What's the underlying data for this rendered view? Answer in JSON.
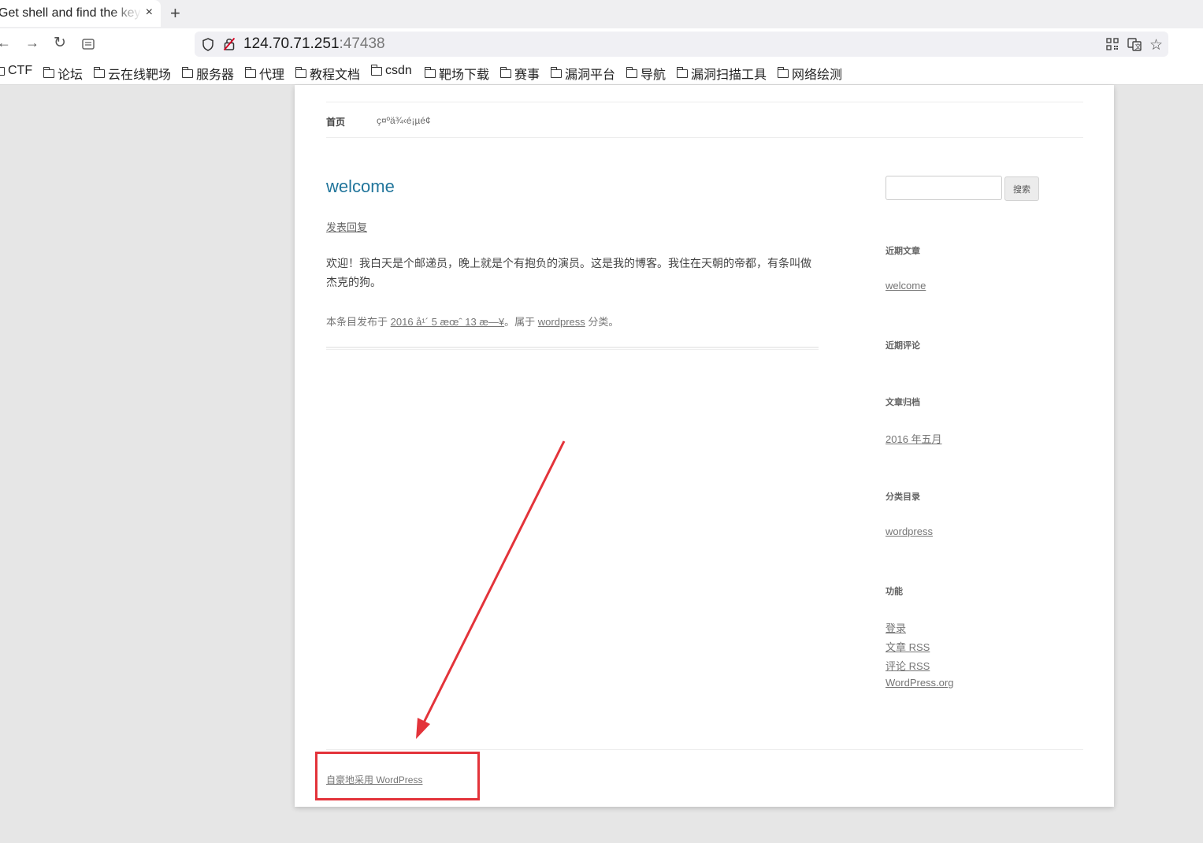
{
  "browser": {
    "tab": {
      "title": "Get shell and find the key",
      "close": "×"
    },
    "new_tab": "+",
    "nav": {
      "back": "←",
      "forward": "→",
      "reload": "↻"
    },
    "url": {
      "host": "124.70.71.251",
      "port": ":47438"
    },
    "bookmarks": [
      "CTF",
      "论坛",
      "云在线靶场",
      "服务器",
      "代理",
      "教程文档",
      "csdn",
      "靶场下载",
      "赛事",
      "漏洞平台",
      "导航",
      "漏洞扫描工具",
      "网络绘测"
    ]
  },
  "site": {
    "menu": [
      "首页",
      "ç¤ºä¾‹é¡µé¢"
    ],
    "post": {
      "title": "welcome",
      "comments_link": "发表回复",
      "content": "欢迎！我白天是个邮递员，晚上就是个有抱负的演员。这是我的博客。我住在天朝的帝都，有条叫做杰克的狗。",
      "meta_prefix": "本条目发布于",
      "meta_date": "2016 å¹´ 5 æœˆ 13 æ—¥",
      "meta_mid": "。属于",
      "meta_category": "wordpress",
      "meta_suffix": "分类。"
    },
    "sidebar": {
      "search_button": "搜索",
      "recent_posts_title": "近期文章",
      "recent_posts": [
        "welcome"
      ],
      "recent_comments_title": "近期评论",
      "archives_title": "文章归档",
      "archives": [
        "2016 年五月"
      ],
      "categories_title": "分类目录",
      "categories": [
        "wordpress"
      ],
      "meta_title": "功能",
      "meta_links": [
        "登录",
        "文章 RSS",
        "评论 RSS",
        "WordPress.org"
      ]
    },
    "footer": "自豪地采用 WordPress"
  },
  "annotation_color": "#e3333a"
}
